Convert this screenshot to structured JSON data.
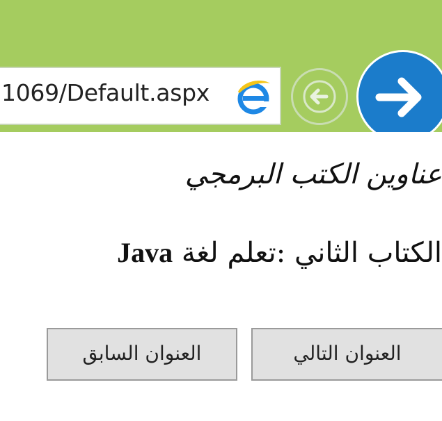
{
  "browser": {
    "address_text": "1069/Default.aspx",
    "back_label": "",
    "forward_label": "",
    "accent_color": "#a5cc5f",
    "forward_color": "#1b7ccb",
    "icons": [
      "ie-icon",
      "back-arrow-icon",
      "forward-arrow-icon"
    ]
  },
  "page": {
    "title": "عناوين الكتب البرمجي",
    "book_line_prefix": "الكتاب الثاني :تعلم لغة",
    "book_line_language": "Java"
  },
  "buttons": {
    "next_label": "العنوان التالي",
    "prev_label": "العنوان السابق"
  }
}
